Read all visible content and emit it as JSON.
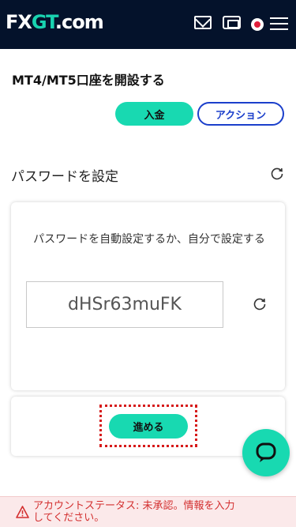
{
  "header": {
    "logo_prefix": "FX",
    "logo_g": "GT",
    "logo_suffix": ".com",
    "icons": [
      "mail-icon",
      "ticket-icon",
      "japan-flag-icon",
      "hamburger-menu-icon"
    ]
  },
  "page": {
    "title": "MT4/MT5口座を開設する",
    "deposit_button": "入金",
    "action_button": "アクション"
  },
  "password_section": {
    "title": "パスワードを設定",
    "description": "パスワードを自動設定するか、自分で設定する",
    "password_value": "dHSr63muFK",
    "proceed_button": "進める"
  },
  "status": {
    "message": "アカウントステータス: 未承認。情報を入力してください。"
  },
  "colors": {
    "header_bg": "#04122b",
    "accent": "#18d9b1",
    "action_blue": "#1b3fcb",
    "warning_red": "#d32f2f"
  }
}
